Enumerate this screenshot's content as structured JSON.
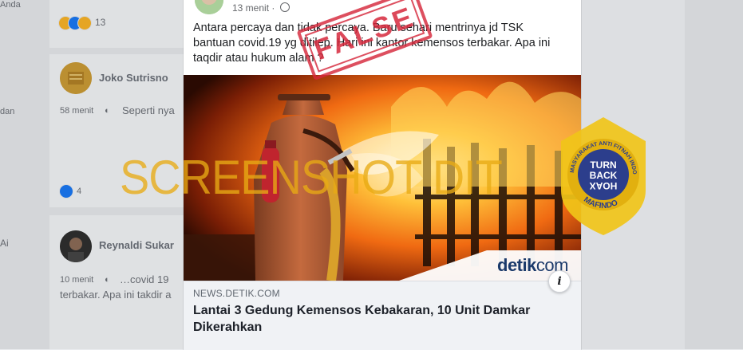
{
  "background": {
    "left_snippets": {
      "anda": "Anda",
      "dan": "dan",
      "ai": "Ai"
    },
    "reaction_count": "13",
    "comments": [
      {
        "name": "Joko Sutrisno",
        "time": "58 menit",
        "text": "Seperti nya",
        "reaction_count": "4"
      },
      {
        "name": "Reynaldi Sukar",
        "time": "10 menit",
        "text": "…covid 19",
        "text_line2": "terbakar. Apa ini takdir a"
      }
    ]
  },
  "post": {
    "time": "13 menit",
    "privacy_icon": "globe-icon",
    "text": "Antara percaya dan tidak percaya. Baru sehari mentrinya jd TSK bantuan covid.19 yg ditilep. Hari ini kantor kemensos terbakar. Apa ini taqdir atau hukum alam ?",
    "image": {
      "brand": "detik",
      "brand_suffix": "com"
    },
    "link": {
      "domain": "NEWS.DETIK.COM",
      "title": "Lantai 3 Gedung Kemensos Kebakaran, 10 Unit Damkar Dikerahkan",
      "info_icon": "i"
    }
  },
  "overlays": {
    "stamp_text": "FALSE",
    "watermark_text": "SCREENSHOT DIT",
    "badge": {
      "line1": "TURN",
      "line2": "BACK",
      "line3": "HOAX",
      "ring_top": "MASYARAKAT ANTI FITNAH INDONESIA",
      "ring_bottom": "MAFINDO"
    }
  },
  "colors": {
    "stamp": "#d6283c",
    "watermark": "#e8aa14",
    "badge": "#f0c419",
    "badge_inner": "#2c3e8c"
  }
}
